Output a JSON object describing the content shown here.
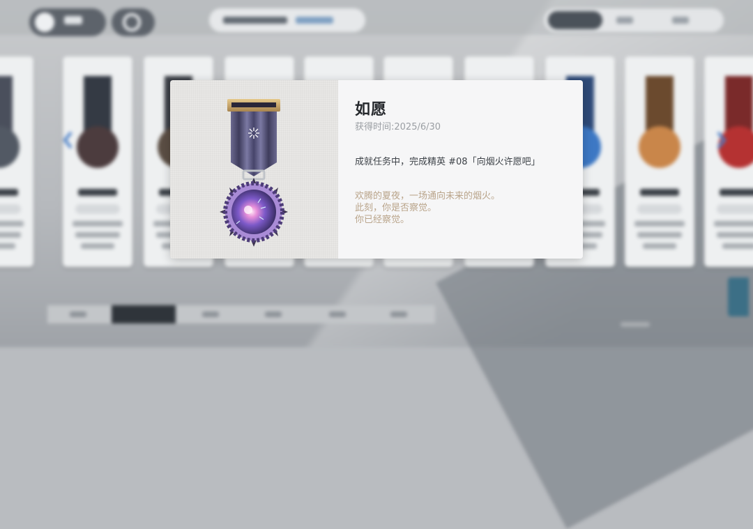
{
  "achievement": {
    "name": "如愿",
    "obtained": "获得时间:2025/6/30",
    "condition": "成就任务中，完成精英 #08「向烟火许愿吧」",
    "flavor": [
      "欢腾的夏夜，一场通向未来的烟火。",
      "此刻，你是否察觉。",
      "你已经察觉。"
    ]
  },
  "icons": {
    "back": "hexagon-back-icon",
    "home": "refresh-home-icon",
    "prev": "chevron-left-icon",
    "next": "chevron-right-icon",
    "medal": "firework-medal-icon"
  },
  "colors": {
    "dialog_left": "#e8e7e5",
    "dialog_right": "#f6f6f7",
    "flavor_text": "#b9a48a",
    "ribbon": "#4a4868",
    "gold_bar": "#c9a46a",
    "orb": "#7a5bc4"
  }
}
